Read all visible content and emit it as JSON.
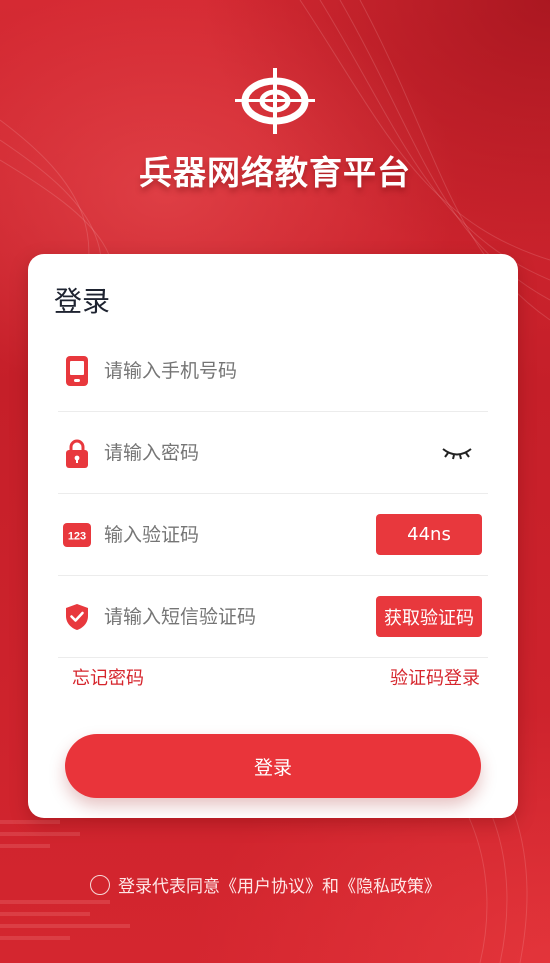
{
  "app": {
    "title": "兵器网络教育平台"
  },
  "login_card": {
    "title": "登录",
    "phone": {
      "placeholder": "请输入手机号码",
      "value": ""
    },
    "password": {
      "placeholder": "请输入密码",
      "value": ""
    },
    "captcha": {
      "placeholder": "输入验证码",
      "value": "",
      "button_label": "44ns"
    },
    "sms": {
      "placeholder": "请输入短信验证码",
      "value": "",
      "button_label": "获取验证码"
    },
    "forgot_label": "忘记密码",
    "code_login_label": "验证码登录",
    "submit_label": "登录"
  },
  "agreement": {
    "prefix": "登录代表同意",
    "user_agreement": "《用户协议》",
    "and": "和",
    "privacy_policy": "《隐私政策》"
  },
  "colors": {
    "brand_red": "#e8383d",
    "background_red": "#c8202a"
  },
  "icons": [
    "phone-icon",
    "lock-icon",
    "captcha-123-icon",
    "shield-check-icon",
    "eye-closed-icon",
    "logo-icon"
  ]
}
